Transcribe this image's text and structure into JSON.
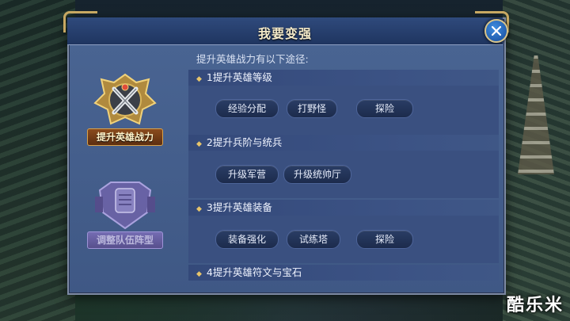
{
  "title": "我要变强",
  "intro": "提升英雄战力有以下途径:",
  "left_tabs": [
    {
      "label": "提升英雄战力"
    },
    {
      "label": "调整队伍阵型"
    }
  ],
  "sections": [
    {
      "heading": "1提升英雄等级",
      "buttons": [
        "经验分配",
        "打野怪",
        "探险"
      ]
    },
    {
      "heading": "2提升兵阶与统兵",
      "buttons": [
        "升级军营",
        "升级统帅厅"
      ]
    },
    {
      "heading": "3提升英雄装备",
      "buttons": [
        "装备强化",
        "试练塔",
        "探险"
      ]
    },
    {
      "heading": "4提升英雄符文与宝石",
      "buttons": []
    }
  ],
  "watermark": "酷乐米",
  "colors": {
    "accent_gold": "#c7a862",
    "panel_blue": "#4a6593",
    "close_blue": "#2f7fd8"
  },
  "icons": {
    "close": "close-icon",
    "bullet": "diamond-bullet-icon"
  }
}
